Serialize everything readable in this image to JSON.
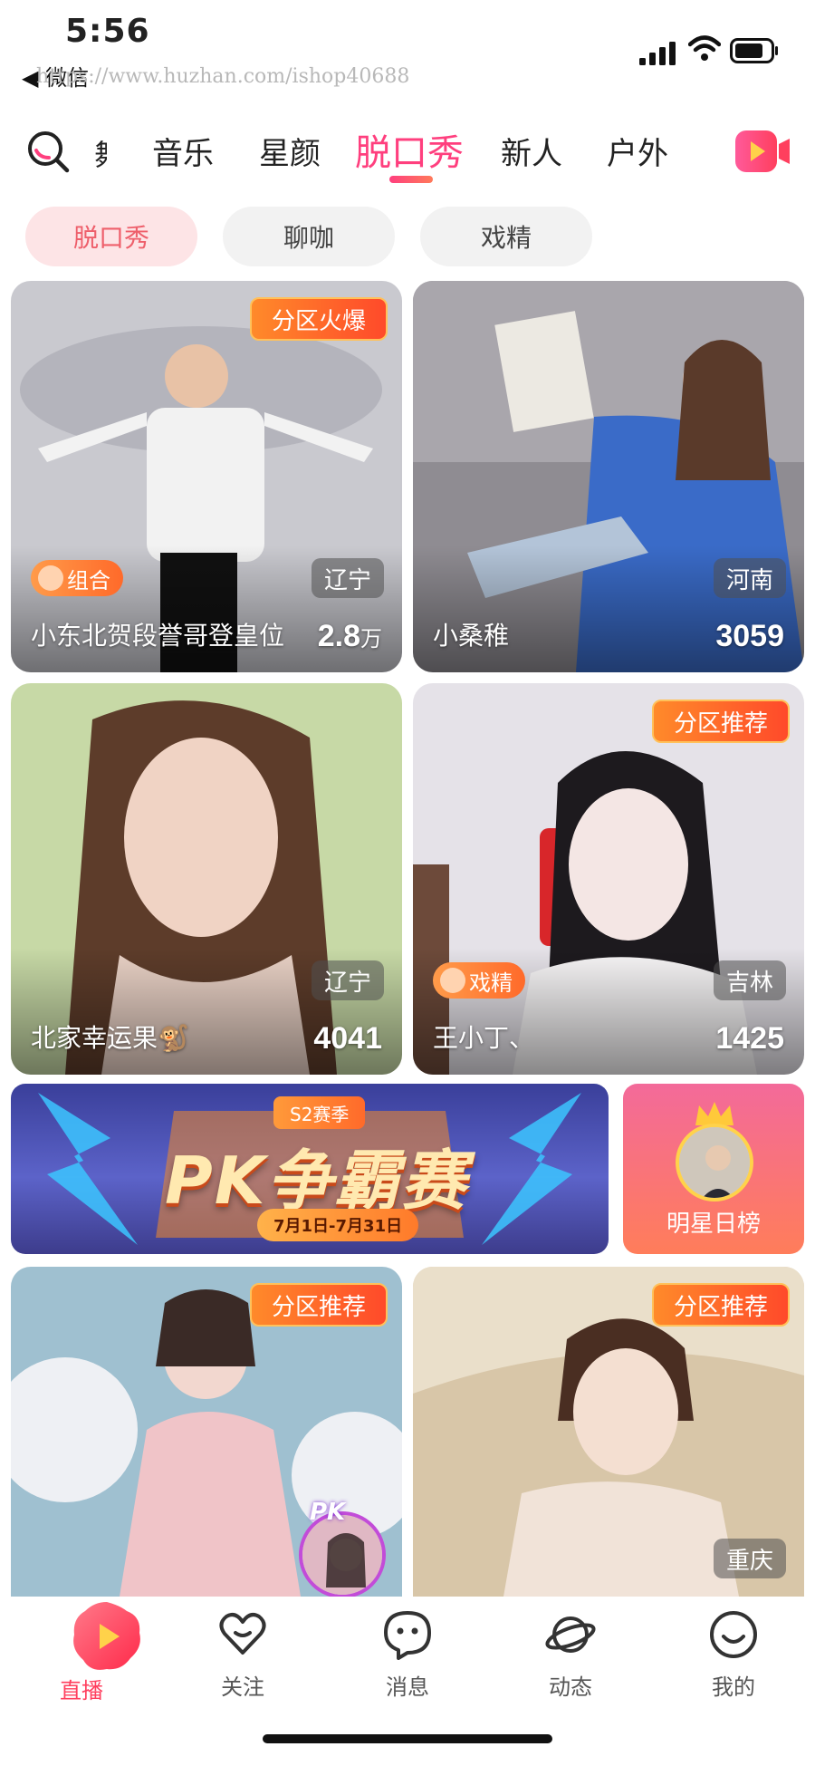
{
  "status_bar": {
    "time": "5:56",
    "back_app": "微信",
    "watermark": "https://www.huzhan.com/ishop40688"
  },
  "nav": {
    "partial_item": "舞",
    "items": [
      "音乐",
      "星颜",
      "脱口秀",
      "新人",
      "户外"
    ],
    "active": "脱口秀"
  },
  "sub_tabs": [
    "脱口秀",
    "聊咖",
    "戏精"
  ],
  "cards": [
    {
      "name": "小东北贺段誉哥登皇位",
      "count": "2.8",
      "unit": "万",
      "region": "辽宁",
      "badge": "分区火爆",
      "tag": "组合"
    },
    {
      "name": "小桑稚",
      "count": "3059",
      "region": "河南"
    },
    {
      "name": "北家幸运果🐒",
      "count": "4041",
      "region": "辽宁"
    },
    {
      "name": "王小丁、",
      "count": "1425",
      "region": "吉林",
      "badge": "分区推荐",
      "tag": "戏精"
    },
    {
      "badge": "分区推荐",
      "pk": "PK"
    },
    {
      "badge": "分区推荐",
      "region": "重庆"
    }
  ],
  "banner": {
    "season": "S2赛季",
    "title": "PK争霸赛",
    "date": "7月1日-7月31日"
  },
  "rank": {
    "label": "明星日榜"
  },
  "tabbar": {
    "items": [
      {
        "label": "直播",
        "icon": "live-icon"
      },
      {
        "label": "关注",
        "icon": "heart-icon"
      },
      {
        "label": "消息",
        "icon": "message-icon"
      },
      {
        "label": "动态",
        "icon": "planet-icon"
      },
      {
        "label": "我的",
        "icon": "smile-icon"
      }
    ],
    "active": "直播"
  },
  "colors": {
    "accent": "#ff3f7e",
    "chip_active_bg": "#fde4e6",
    "badge_orange": "#ff6a2a"
  }
}
